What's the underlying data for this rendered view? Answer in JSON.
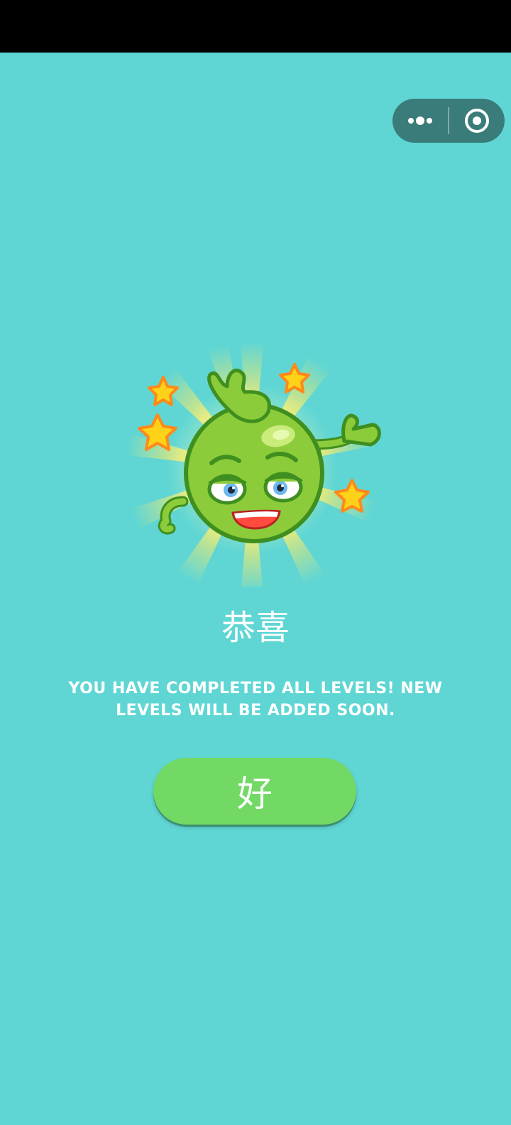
{
  "dialog": {
    "title": "恭喜",
    "message": "YOU HAVE COMPLETED ALL LEVELS! NEW LEVELS WILL BE ADDED SOON.",
    "ok_label": "好"
  },
  "capsule": {
    "more_icon": "more-dots-icon",
    "close_icon": "target-close-icon"
  },
  "icons": {
    "mascot": "green-pea-mascot-icon",
    "star": "star-icon",
    "burst": "sunburst-icon"
  },
  "colors": {
    "background": "#5fd6d4",
    "status_bar": "#000000",
    "capsule": "#3a7c79",
    "button": "#72d964",
    "text": "#ffffff",
    "mascot": "#8ccc3a",
    "star": "#ffd21a",
    "star_outline": "#ff8a1a"
  }
}
